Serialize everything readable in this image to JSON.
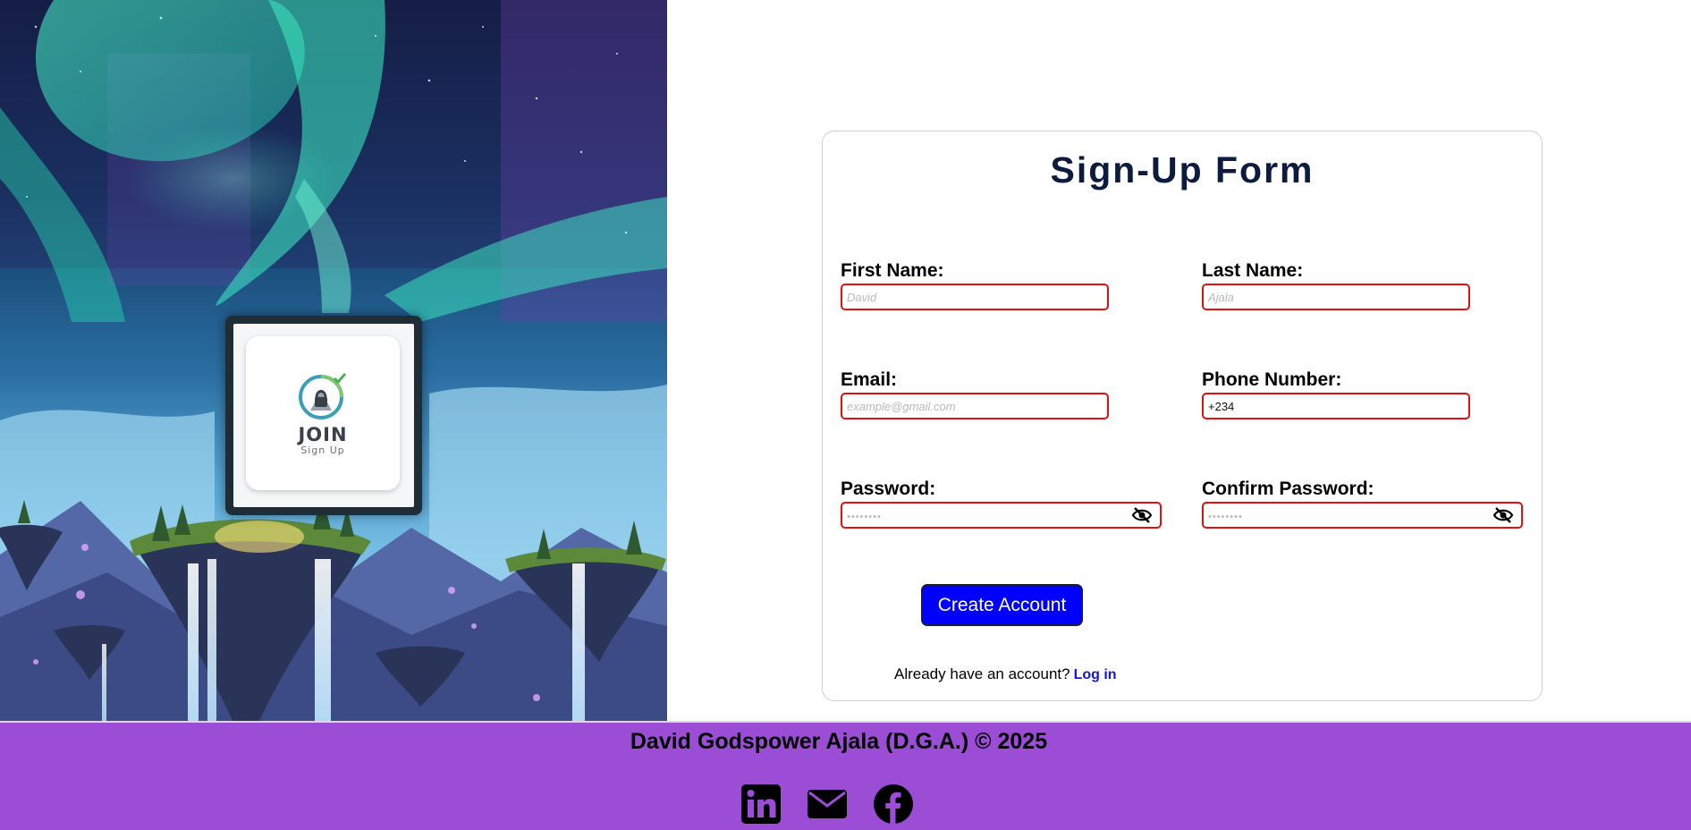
{
  "brand": {
    "logo_title": "JOIN",
    "logo_subtitle": "Sign Up"
  },
  "form": {
    "title": "Sign-Up Form",
    "fields": {
      "first_name": {
        "label": "First Name:",
        "placeholder": "David",
        "value": ""
      },
      "last_name": {
        "label": "Last Name:",
        "placeholder": "Ajala",
        "value": ""
      },
      "email": {
        "label": "Email:",
        "placeholder": "example@gmail.com",
        "value": ""
      },
      "phone": {
        "label": "Phone Number:",
        "placeholder": "",
        "value": "+234"
      },
      "password": {
        "label": "Password:",
        "placeholder": "••••••••",
        "value": ""
      },
      "confirm_password": {
        "label": "Confirm Password:",
        "placeholder": "••••••••",
        "value": ""
      }
    },
    "submit_label": "Create Account",
    "login_prompt": "Already have an account?",
    "login_link": "Log in"
  },
  "footer": {
    "copyright": "David Godspower Ajala (D.G.A.) © 2025",
    "socials": [
      "linkedin-icon",
      "email-icon",
      "facebook-icon"
    ]
  },
  "colors": {
    "accent": "#0000ff",
    "title": "#0d1b3e",
    "input_border": "#e01010",
    "footer_bg": "#9b4dd6",
    "link": "#1515d8"
  }
}
